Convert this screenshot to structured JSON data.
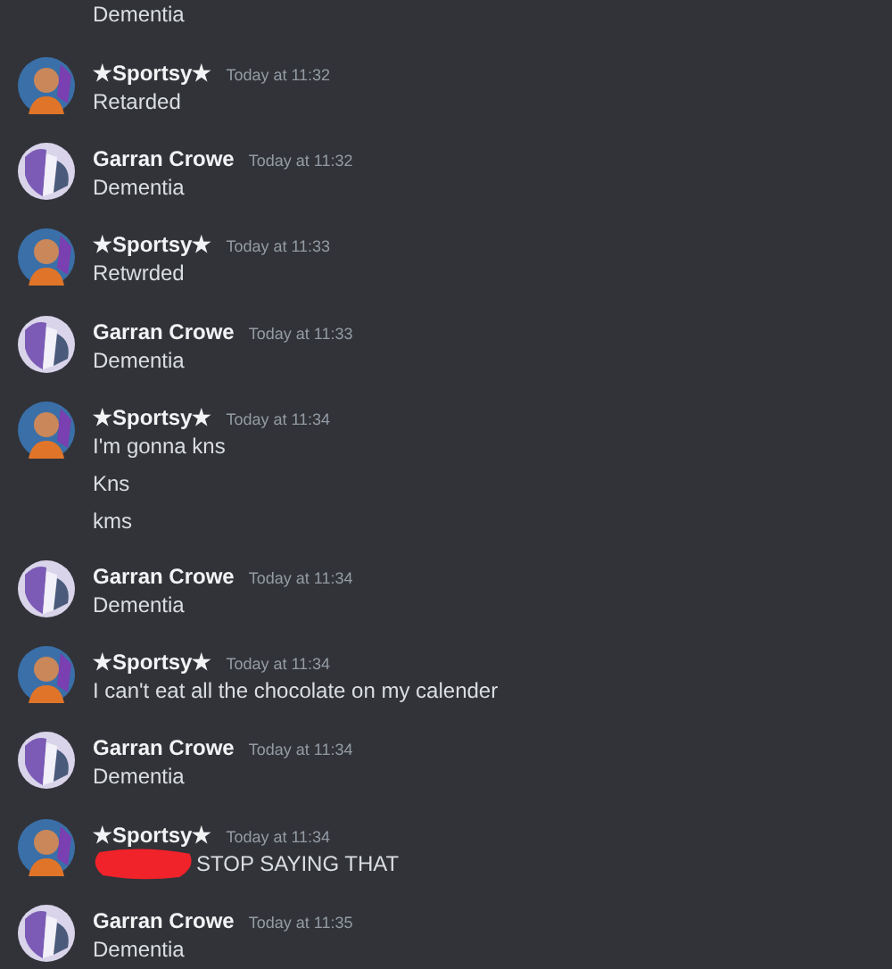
{
  "messages": [
    {
      "lines": [
        {
          "text": "Dementia"
        }
      ]
    },
    {
      "author": "★Sportsy★",
      "avatar": {
        "kind": "character"
      },
      "time": "Today at 11:32",
      "lines": [
        {
          "text": "Retarded"
        }
      ]
    },
    {
      "author": "Garran Crowe",
      "avatar": {
        "kind": "abstract"
      },
      "time": "Today at 11:32",
      "lines": [
        {
          "text": "Dementia"
        }
      ]
    },
    {
      "author": "★Sportsy★",
      "avatar": {
        "kind": "character"
      },
      "time": "Today at 11:33",
      "lines": [
        {
          "text": "Retwrded"
        }
      ]
    },
    {
      "author": "Garran Crowe",
      "avatar": {
        "kind": "abstract"
      },
      "time": "Today at 11:33",
      "lines": [
        {
          "text": "Dementia"
        }
      ]
    },
    {
      "author": "★Sportsy★",
      "avatar": {
        "kind": "character"
      },
      "time": "Today at 11:34",
      "lines": [
        {
          "text": "I'm gonna kns"
        },
        {
          "text": "Kns"
        },
        {
          "text": "kms"
        }
      ]
    },
    {
      "author": "Garran Crowe",
      "avatar": {
        "kind": "abstract"
      },
      "time": "Today at 11:34",
      "lines": [
        {
          "text": "Dementia"
        }
      ]
    },
    {
      "author": "★Sportsy★",
      "avatar": {
        "kind": "character"
      },
      "time": "Today at 11:34",
      "lines": [
        {
          "text": "I can't eat all the chocolate on my calender"
        }
      ]
    },
    {
      "author": "Garran Crowe",
      "avatar": {
        "kind": "abstract"
      },
      "time": "Today at 11:34",
      "lines": [
        {
          "text": "Dementia"
        }
      ]
    },
    {
      "author": "★Sportsy★",
      "avatar": {
        "kind": "character"
      },
      "time": "Today at 11:34",
      "lines": [
        {
          "text": "STOP SAYING THAT",
          "redacted": true
        }
      ]
    },
    {
      "author": "Garran Crowe",
      "avatar": {
        "kind": "abstract"
      },
      "time": "Today at 11:35",
      "lines": [
        {
          "text": "Dementia"
        }
      ]
    }
  ]
}
